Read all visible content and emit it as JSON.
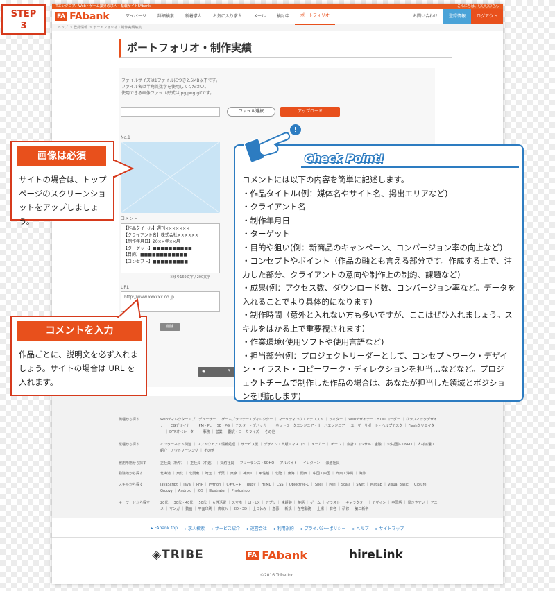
{
  "step": {
    "label": "STEP",
    "num": "3"
  },
  "topbar": {
    "left": "ITエンジニア、Web・ゲーム業界の求人・転職サイトFAbank",
    "right": "こんにちは、〇〇〇〇さん"
  },
  "nav": {
    "logo_mark": "FA",
    "logo_text": "FAbank",
    "items": [
      "マイページ",
      "詳細検索",
      "新着求人",
      "お気に入り求人",
      "メール",
      "検討中",
      "ポートフォリオ"
    ],
    "contact": "お問い合わせ",
    "register": "登録情報",
    "logout": "ログアウト"
  },
  "breadcrumb": "トップ ＞ 登録情報 ＞ ポートフォリオ・制作実績編集",
  "page_title": "ポートフォリオ・制作実績",
  "form": {
    "notes": [
      "ファイルサイズは1ファイルにつき2.5MB以下です。",
      "ファイル名は半角英数字を使用してください。",
      "使用できる画像ファイル形式はjpg,png,gifです。"
    ],
    "file_button": "ファイル選択",
    "upload_button": "アップロード",
    "no_label": "No.1",
    "comment_label": "コメント",
    "comment_lines": [
      "【作品タイトル】週刊×××××××",
      "【クライアント名】株式会社××××××",
      "【制作年月日】20××年××月",
      "【ターゲット】■■■■■■■■■■",
      "【目的】■■■■■■■■■■■■",
      "【コンセプト】■■■■■■■■■"
    ],
    "counter": "※残り169文字 / 200文字",
    "url_label": "URL",
    "url_value": "http://www.xxxxxx.co.jp",
    "delete_button": "削除",
    "pager_label": "3"
  },
  "callout_image": {
    "title": "画像は必須",
    "body": [
      "サイトの場合は、トップ",
      "ページのスクリーンショ",
      "ットをアップしましょう。"
    ]
  },
  "callout_comment": {
    "title": "コメントを入力",
    "body": [
      "作品ごとに、説明文を必ず入れま",
      "しょう。サイトの場合は URL を",
      "入れます。"
    ]
  },
  "checkpoint": {
    "title": "Check Point!",
    "lines": [
      "コメントには以下の内容を簡単に記述します。",
      "・作品タイトル(例：媒体名やサイト名、掲出エリアなど)",
      "・クライアント名",
      "・制作年月日",
      "・ターゲット",
      "・目的や狙い(例：新商品のキャンペーン、コンバージョン率の向上など)",
      "・コンセプトやポイント（作品の軸とも言える部分です。作成する上で、注",
      "力した部分、クライアントの意向や制作上の制約、課題など)",
      "・成果(例：アクセス数、ダウンロード数、コンバージョン率など。データを",
      "入れることでより具体的になります)",
      "・制作時間（意外と入れない方も多いですが、ここはぜひ入れましょう。ス",
      "キルをはかる上で重要視されます）",
      "・作業環境(使用ソフトや使用言語など)",
      "・担当部分(例：プロジェクトリーダーとして、コンセプトワーク・デザイ",
      "ン・イラスト・コピーワーク・ディレクションを担当…などなど。プロジ",
      "ェクトチームで制作した作品の場合は、あなたが担当した領域とポジショ",
      "ンを明記します)"
    ]
  },
  "footer": {
    "rows": [
      {
        "label": "職種から探す",
        "items": "Webディレクター・プロデューサー ｜ ゲームプランナー・ディレクター ｜ マーケティング・アナリスト ｜ ライター ｜ Webデザイナー・HTMLコーダー ｜ グラフィックデザイナー・CGデザイナー ｜ PM・PL ｜ SE・PG ｜ テスター・デバッガー ｜ ネットワークエンジニア・サーバエンジニア ｜ ユーザーサポート・ヘルプデスク ｜ Flashクリエイター ｜ DTPオペレーター ｜ 事務 ｜ 営業 ｜ 翻訳・ローカライズ ｜ その他"
      },
      {
        "label": "業種から探す",
        "items": "インターネット関連 ｜ ソフトウェア・情報処理 ｜ サービス業 ｜ デザイン・出版・マスコミ ｜ メーカー ｜ ゲーム ｜ 会計・コンサル・金融 ｜ 公共団体・NPO ｜ 人材派遣・紹介・アウトソーシング ｜ その他"
      },
      {
        "label": "雇用形態から探す",
        "items": "正社員（新卒） ｜ 正社員（中途） ｜ 契約社員 ｜ フリーランス・SOHO ｜ アルバイト ｜ インターン ｜ 派遣社員"
      },
      {
        "label": "勤務地から探す",
        "items": "北海道 ｜ 東北 ｜ 北関東 ｜ 埼玉 ｜ 千葉 ｜ 東京 ｜ 神奈川 ｜ 甲信越 ｜ 北陸 ｜ 東海 ｜ 関西 ｜ 中国・四国 ｜ 九州・沖縄 ｜ 海外"
      },
      {
        "label": "スキルから探す",
        "items": "JavaScript ｜ Java ｜ PHP ｜ Python ｜ C#/C++ ｜ Ruby ｜ HTML ｜ CSS ｜ Objective-C ｜ Shell ｜ Perl ｜ Scala ｜ Swift ｜ Matlab ｜ Visual Basic ｜ Clojure ｜ Groovy ｜ Android ｜ iOS ｜ Illustrator ｜ Photoshop"
      },
      {
        "label": "キーワードから探す",
        "items": "20代 ｜ 30代・40代 ｜ 50代 ｜ 女性活躍 ｜ スマホ ｜ UI・UX ｜ アプリ ｜ 未経験 ｜ 英語 ｜ ゲーム ｜ イラスト ｜ キャラクター ｜ デザイン ｜ 中国語 ｜ 働きやすい ｜ アニメ ｜ マンガ ｜ 動画 ｜ 平面印刷 ｜ 高収入 ｜ 2D・3D ｜ 土日休み ｜ 急募 ｜ 新規 ｜ 在宅勤務 ｜ 上場 ｜ 有名 ｜ 研修 ｜ 第二新卒"
      }
    ],
    "links": [
      "▸ FAbank top",
      "▸ 求人検索",
      "▸ サービス紹介",
      "▸ 運営会社",
      "▸ 利用規約",
      "▸ プライバシーポリシー",
      "▸ ヘルプ",
      "▸ サイトマップ"
    ],
    "brand_tribe": "TRIBE",
    "brand_fabank_mark": "FA",
    "brand_fabank": "FAbank",
    "brand_hire": "hireLink",
    "copyright": "©2016 Tribe Inc."
  }
}
